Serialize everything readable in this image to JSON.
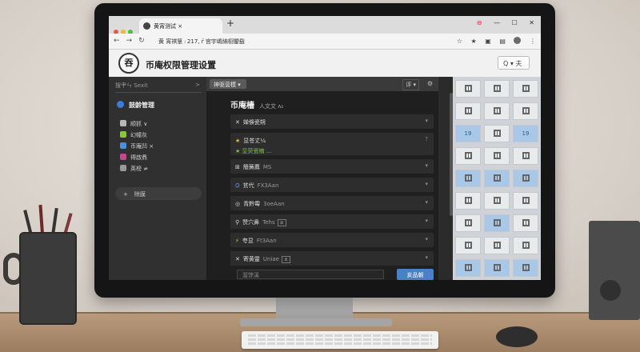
{
  "browser": {
    "tab_title": "黄宵测试 ×",
    "tab_close": "×",
    "new_tab": "+",
    "address_text": "黄 宵祺篁 ᵢ 217, r̈ 宫宇嶋納栩鑒鼗",
    "window_controls": [
      "⊖",
      "—",
      "☐",
      "✕"
    ],
    "toolbar_icons": [
      "☆",
      "★",
      "▣",
      "▤"
    ],
    "menu_glyph": "⋮"
  },
  "app": {
    "logo_text": "吞",
    "title": "币庵权限管理设置",
    "search_box": "Q ▾ 夫"
  },
  "sidebar": {
    "search_placeholder": "搜肀ㄣ Sexit",
    "search_chevron": ">",
    "section_label": "鼓龄管理",
    "items": [
      {
        "label": "顺抓 ∨",
        "icon_color": "#b8b8b8"
      },
      {
        "label": "幻幢灰",
        "icon_color": "#8cc43f"
      },
      {
        "label": "币庵凹 ×",
        "icon_color": "#4c8fd6"
      },
      {
        "label": "得啟鼎",
        "icon_color": "#c04b8b"
      },
      {
        "label": "英榜 ≠",
        "icon_color": "#9a9a9a"
      }
    ],
    "add_label": "除膜",
    "add_plus": "+"
  },
  "main": {
    "filter_label": "神驱营模 ▾",
    "sort_label": "评 ▾",
    "gear": "⚙",
    "title": "币庵檣",
    "title_sub": "人文文 ᴧ₀",
    "rows": [
      {
        "icon": "✕",
        "label": "婵倏瓷朔",
        "muted": "",
        "tag": "",
        "chev": "▾"
      },
      {
        "icon": "★",
        "label": "显苍丈¼",
        "muted": "",
        "tag": "",
        "chev": "?",
        "line2": "★ 显荧瓷楠 ...",
        "tall": true
      },
      {
        "icon": "⊞",
        "label": "簡簧薦",
        "muted": "MS",
        "tag": "",
        "chev": "▾"
      },
      {
        "icon": "⛭",
        "label": "贫代",
        "muted": "FX3Aan",
        "tag": "",
        "chev": "▾"
      },
      {
        "icon": "◎",
        "label": "青黔霉",
        "muted": "3oeAan",
        "tag": "",
        "chev": "▾"
      },
      {
        "icon": "⚲",
        "label": "赞穴鼻",
        "muted": "Tehs",
        "tag": "±",
        "chev": "▾"
      },
      {
        "icon": "⚡",
        "label": "夸显",
        "muted": "Ft3Aan",
        "tag": "",
        "chev": "▾"
      },
      {
        "icon": "✕",
        "label": "寄黄靈",
        "muted": "Uniae",
        "tag": "±",
        "chev": "▾"
      }
    ],
    "input_placeholder": "渥馀溪",
    "submit_label": "亥品朝"
  },
  "grid_tiles": [
    {
      "text": "",
      "blue": false
    },
    {
      "text": "",
      "blue": false
    },
    {
      "text": "",
      "blue": false
    },
    {
      "text": "",
      "blue": false
    },
    {
      "text": "",
      "blue": false
    },
    {
      "text": "",
      "blue": false
    },
    {
      "text": "19",
      "blue": true
    },
    {
      "text": "",
      "blue": false
    },
    {
      "text": "19",
      "blue": true
    },
    {
      "text": "",
      "blue": false
    },
    {
      "text": "",
      "blue": false
    },
    {
      "text": "",
      "blue": false
    },
    {
      "text": "",
      "blue": true
    },
    {
      "text": "",
      "blue": true
    },
    {
      "text": "",
      "blue": true
    },
    {
      "text": "",
      "blue": false
    },
    {
      "text": "",
      "blue": false
    },
    {
      "text": "",
      "blue": false
    },
    {
      "text": "",
      "blue": false
    },
    {
      "text": "",
      "blue": true
    },
    {
      "text": "",
      "blue": false
    },
    {
      "text": "",
      "blue": false
    },
    {
      "text": "",
      "blue": false
    },
    {
      "text": "",
      "blue": false
    },
    {
      "text": "",
      "blue": true
    },
    {
      "text": "",
      "blue": true
    },
    {
      "text": "",
      "blue": true
    }
  ],
  "colors": {
    "accent_blue": "#4a80c8",
    "sidebar_bg": "#303030",
    "main_bg": "#1f1f1f",
    "row_bg": "#2d2d2d"
  }
}
